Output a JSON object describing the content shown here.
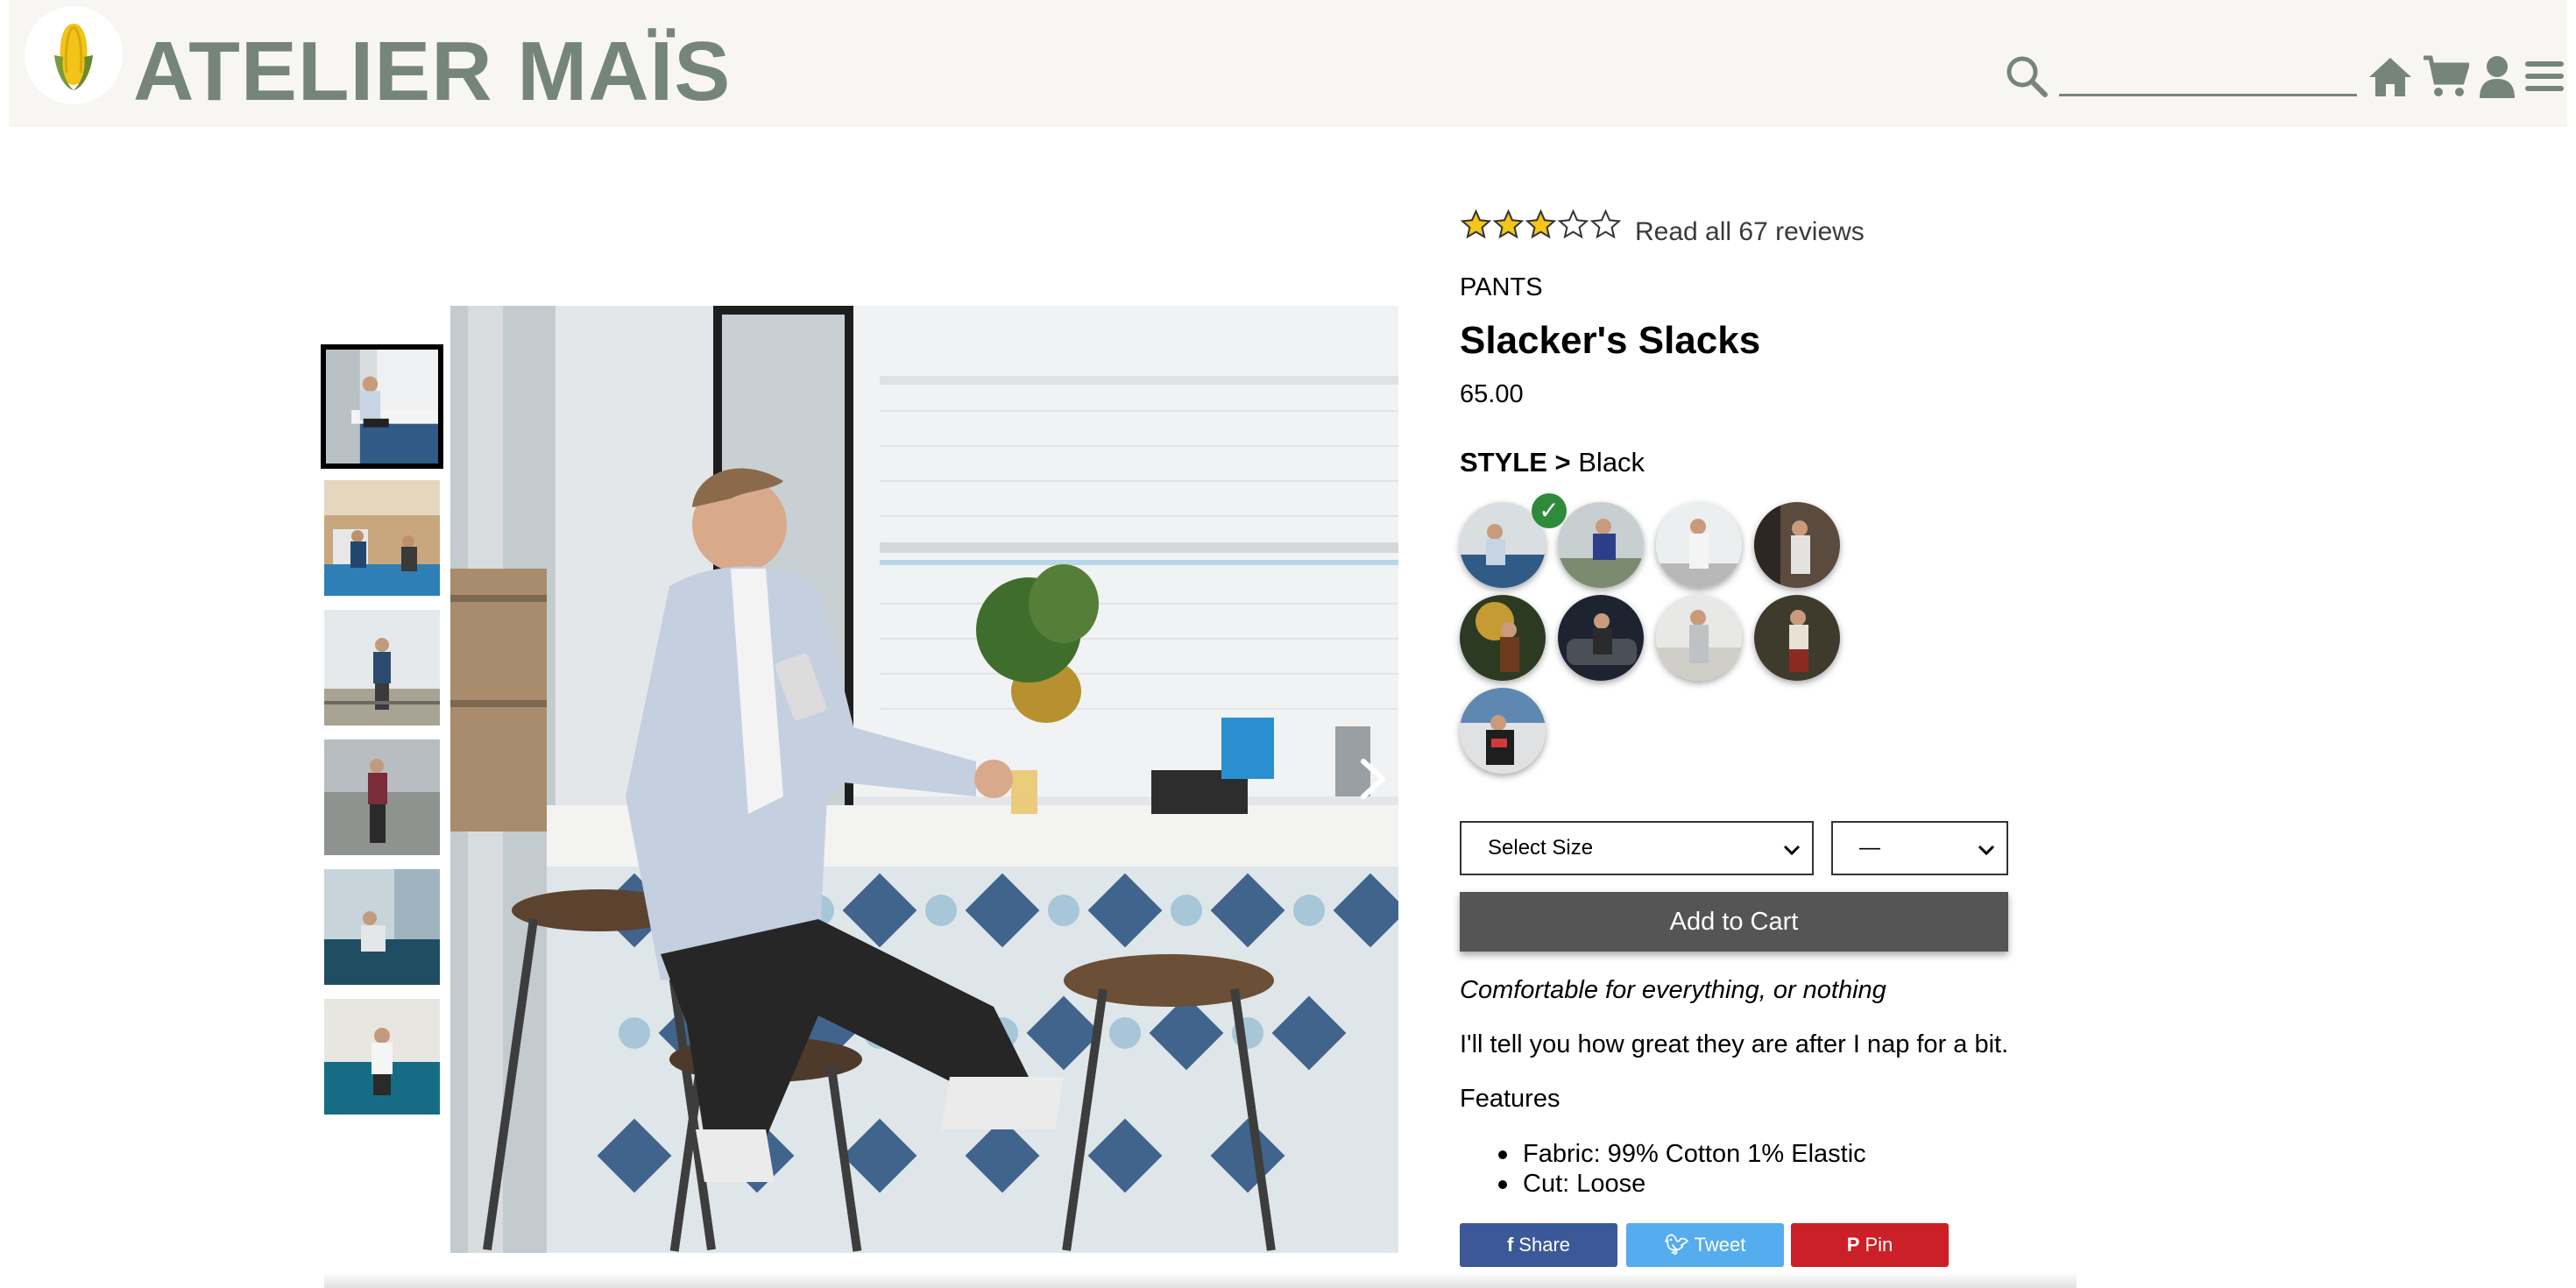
{
  "header": {
    "brand": "ATELIER MAÏS",
    "search_placeholder": "",
    "logo_icon": "corn-icon",
    "icons": [
      "search-icon",
      "home-icon",
      "cart-icon",
      "user-icon",
      "menu-icon"
    ],
    "accent_color": "#75857a"
  },
  "rating": {
    "stars": 3,
    "max_stars": 5,
    "reviews_text": "Read all 67 reviews"
  },
  "product": {
    "category": "PANTS",
    "name": "Slacker's Slacks",
    "price": "65.00",
    "style_label": "STYLE >",
    "style_selected": "Black",
    "style_count": 9,
    "check_mark": "✓",
    "size_select": "Select Size",
    "qty_select": "—",
    "add_to_cart": "Add to Cart",
    "slogan": "Comfortable for everything, or nothing",
    "description": "I'll tell you how great they are after I nap for a bit.",
    "features_title": "Features",
    "features": [
      "Fabric: 99% Cotton 1% Elastic",
      "Cut: Loose"
    ]
  },
  "gallery": {
    "thumbnail_count": 6,
    "selected_index": 0
  },
  "share": {
    "share": "Share",
    "tweet": "Tweet",
    "pin": "Pin",
    "share_color": "#3b5998",
    "tweet_color": "#55acee",
    "pin_color": "#cb2027"
  }
}
